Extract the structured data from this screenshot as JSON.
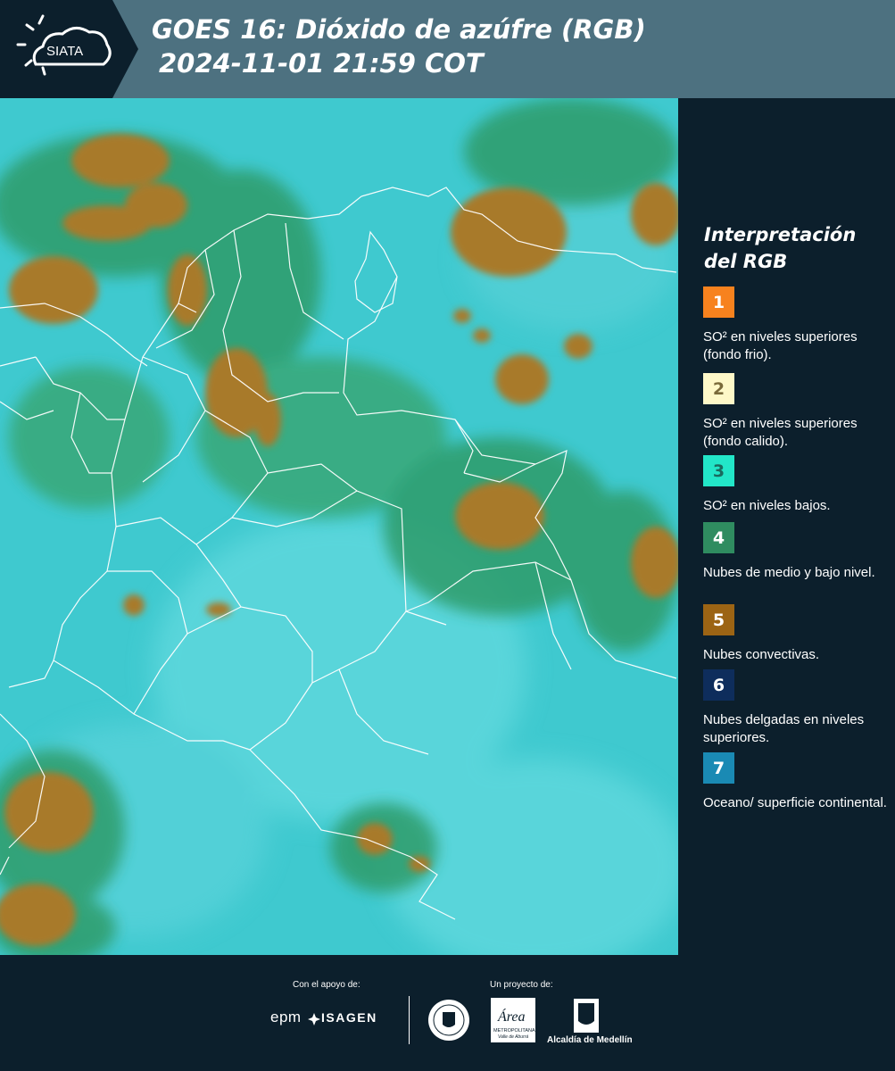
{
  "header": {
    "logo_text": "SIATA",
    "title_line1": "GOES 16: Dióxido de azúfre (RGB)",
    "title_line2": "2024-11-01 21:59 COT"
  },
  "legend": {
    "title": "Interpretación del RGB",
    "items": [
      {
        "number": "1",
        "color": "#f7821e",
        "num_color": "#ffffff",
        "text": "SO² en niveles superiores (fondo frio)."
      },
      {
        "number": "2",
        "color": "#fef8c8",
        "num_color": "#7a6a3a",
        "text": "SO² en niveles superiores (fondo calido)."
      },
      {
        "number": "3",
        "color": "#22e6c8",
        "num_color": "#1a6a5e",
        "text": "SO² en niveles bajos."
      },
      {
        "number": "4",
        "color": "#2f8c60",
        "num_color": "#ffffff",
        "text": "Nubes de medio y bajo nivel."
      },
      {
        "number": "5",
        "color": "#9c6414",
        "num_color": "#ffffff",
        "text": "Nubes convectivas."
      },
      {
        "number": "6",
        "color": "#0e2d5c",
        "num_color": "#ffffff",
        "text": "Nubes delgadas en niveles superiores."
      },
      {
        "number": "7",
        "color": "#1a8ab4",
        "num_color": "#ffffff",
        "text": "Oceano/ superficie continental."
      }
    ]
  },
  "footer": {
    "support_label": "Con el apoyo de:",
    "project_label": "Un proyecto de:",
    "epm_text": "epm",
    "isagen_text": "ISAGEN",
    "area_text": "Área",
    "area_sub1": "METROPOLITANA",
    "area_sub2": "Valle de Aburrá",
    "alcaldia_text": "Alcaldía de Medellín"
  }
}
